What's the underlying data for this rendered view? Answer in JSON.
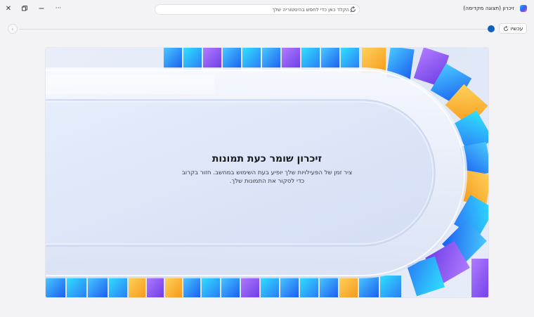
{
  "window": {
    "title": "זיכרון (תצוגה מקדימה)",
    "app_icon": "recall-icon",
    "controls": [
      "close-icon",
      "restore-icon",
      "minimize-icon",
      "more-icon"
    ]
  },
  "search": {
    "placeholder": "הקלד כאן כדי לחפש בהיסטוריה שלך",
    "icon": "search-refresh-icon"
  },
  "timeline": {
    "back_icon": "chevron-left-icon",
    "now_label": "עכשיו",
    "now_icon": "refresh-icon",
    "position_color": "#0f5fbd"
  },
  "hero": {
    "title": "זיכרון שומר כעת תמונות",
    "description": "ציר זמן של הפעילויות שלך יופיע בעת השימוש במחשב. חזור בקרוב כדי לסקור את התמונות שלך."
  },
  "colors": {
    "background": "#f3f3f6",
    "accent": "#0f5fbd"
  }
}
